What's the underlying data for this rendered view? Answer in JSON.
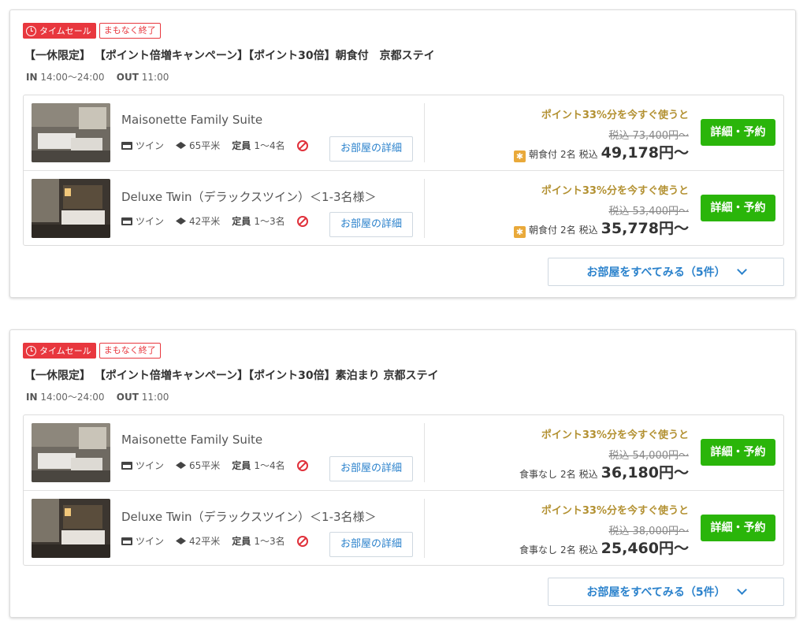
{
  "plans": [
    {
      "badge_sale": "タイムセール",
      "badge_end": "まもなく終了",
      "title": "【一休限定】 【ポイント倍増キャンペーン】【ポイント30倍】朝食付　京都ステイ",
      "checkin_label": "IN",
      "checkin_time": "14:00〜24:00",
      "checkout_label": "OUT",
      "checkout_time": "11:00",
      "rooms": [
        {
          "name": "Maisonette Family Suite",
          "bed": "ツイン",
          "area": "65平米",
          "capacity_label": "定員",
          "capacity": "1〜4名",
          "detail_btn": "お部屋の詳細",
          "point_text": "ポイント33%分を今すぐ使うと",
          "old_price": "税込 73,400円〜",
          "meal": "朝食付",
          "meal_icon": "sun-icon",
          "guests": "2名",
          "tax_label": "税込",
          "price": "49,178円〜",
          "book_btn": "詳細・予約"
        },
        {
          "name": "Deluxe Twin（デラックスツイン）＜1-3名様＞",
          "bed": "ツイン",
          "area": "42平米",
          "capacity_label": "定員",
          "capacity": "1〜3名",
          "detail_btn": "お部屋の詳細",
          "point_text": "ポイント33%分を今すぐ使うと",
          "old_price": "税込 53,400円〜",
          "meal": "朝食付",
          "meal_icon": "sun-icon",
          "guests": "2名",
          "tax_label": "税込",
          "price": "35,778円〜",
          "book_btn": "詳細・予約"
        }
      ],
      "see_all": "お部屋をすべてみる（5件）"
    },
    {
      "badge_sale": "タイムセール",
      "badge_end": "まもなく終了",
      "title": "【一休限定】 【ポイント倍増キャンペーン】【ポイント30倍】素泊まり 京都ステイ",
      "checkin_label": "IN",
      "checkin_time": "14:00〜24:00",
      "checkout_label": "OUT",
      "checkout_time": "11:00",
      "rooms": [
        {
          "name": "Maisonette Family Suite",
          "bed": "ツイン",
          "area": "65平米",
          "capacity_label": "定員",
          "capacity": "1〜4名",
          "detail_btn": "お部屋の詳細",
          "point_text": "ポイント33%分を今すぐ使うと",
          "old_price": "税込 54,000円〜",
          "meal": "食事なし",
          "guests": "2名",
          "tax_label": "税込",
          "price": "36,180円〜",
          "book_btn": "詳細・予約"
        },
        {
          "name": "Deluxe Twin（デラックスツイン）＜1-3名様＞",
          "bed": "ツイン",
          "area": "42平米",
          "capacity_label": "定員",
          "capacity": "1〜3名",
          "detail_btn": "お部屋の詳細",
          "point_text": "ポイント33%分を今すぐ使うと",
          "old_price": "税込 38,000円〜",
          "meal": "食事なし",
          "guests": "2名",
          "tax_label": "税込",
          "price": "25,460円〜",
          "book_btn": "詳細・予約"
        }
      ],
      "see_all": "お部屋をすべてみる（5件）"
    }
  ],
  "colors": {
    "sale_red": "#e8373e",
    "point_gold": "#b39132",
    "book_green": "#2ab50a",
    "link_blue": "#2b82cc"
  }
}
